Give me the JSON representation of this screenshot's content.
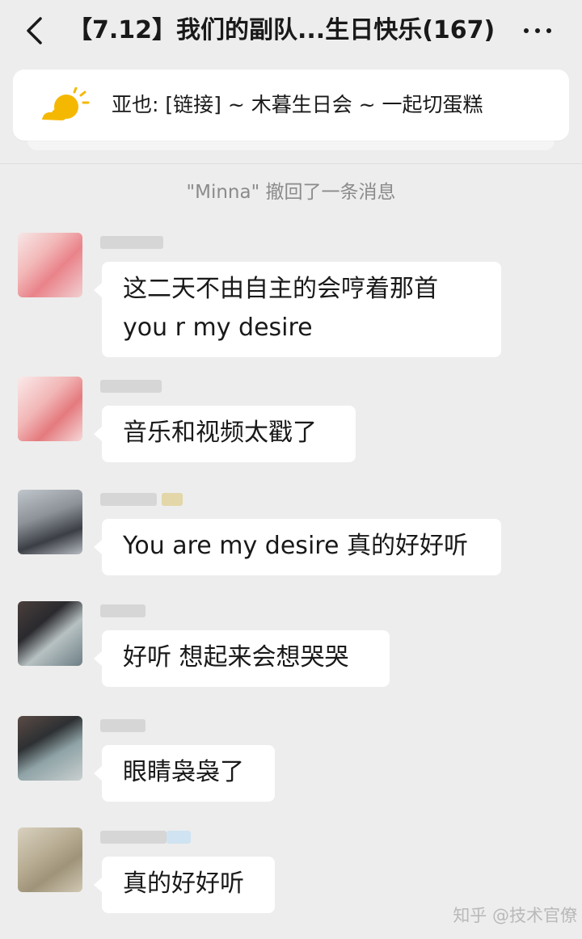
{
  "header": {
    "title": "【7.12】我们的副队...生日快乐(167)"
  },
  "pinned": {
    "text": "亚也: [链接] ~ 木暮生日会 ~ 一起切蛋糕",
    "icon": "sun-cloud-icon"
  },
  "system_message": "\"Minna\" 撤回了一条消息",
  "messages": [
    {
      "line1": "这二天不由自主的会哼着那首",
      "line2": "you r my desire"
    },
    {
      "line1": "音乐和视频太戳了"
    },
    {
      "line1": "You are my desire 真的好好听"
    },
    {
      "line1": "好听 想起来会想哭哭"
    },
    {
      "line1": "眼睛袅袅了"
    },
    {
      "line1": "真的好好听"
    }
  ],
  "watermark": "知乎 @技术官僚"
}
